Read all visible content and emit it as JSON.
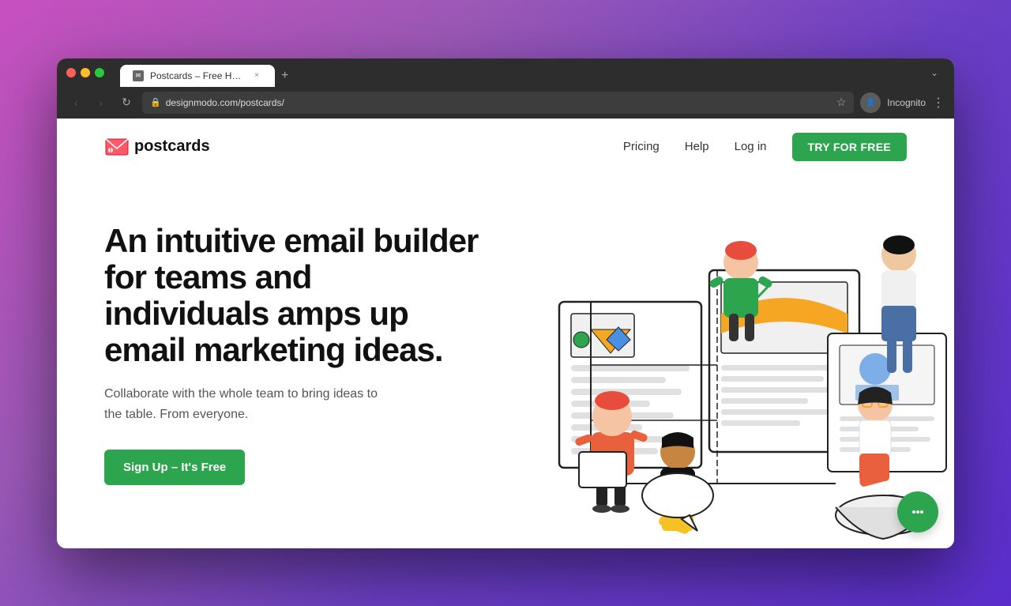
{
  "browser": {
    "titlebar": {
      "traffic_lights": [
        "red",
        "yellow",
        "green"
      ]
    },
    "tab": {
      "title": "Postcards – Free HTML Email",
      "favicon": "✉",
      "close_label": "×",
      "new_tab_label": "+"
    },
    "addressbar": {
      "back_label": "‹",
      "forward_label": "›",
      "refresh_label": "↻",
      "url": "designmodo.com/postcards/",
      "lock_icon": "🔒",
      "star_label": "☆",
      "profile_label": "Incognito",
      "menu_label": "⋮",
      "tab_menu_label": "⌄"
    }
  },
  "site": {
    "nav": {
      "logo_text": "postcards",
      "pricing_label": "Pricing",
      "help_label": "Help",
      "login_label": "Log in",
      "try_label": "TRY FOR FREE"
    },
    "hero": {
      "headline": "An intuitive email builder for teams and individuals amps up email marketing ideas.",
      "subtext": "Collaborate with the whole team to bring ideas to the table. From everyone.",
      "cta_label": "Sign Up – It's Free"
    },
    "chat": {
      "icon": "💬"
    }
  },
  "colors": {
    "green": "#2da44e",
    "dark": "#111111",
    "gray": "#555555",
    "white": "#ffffff"
  }
}
